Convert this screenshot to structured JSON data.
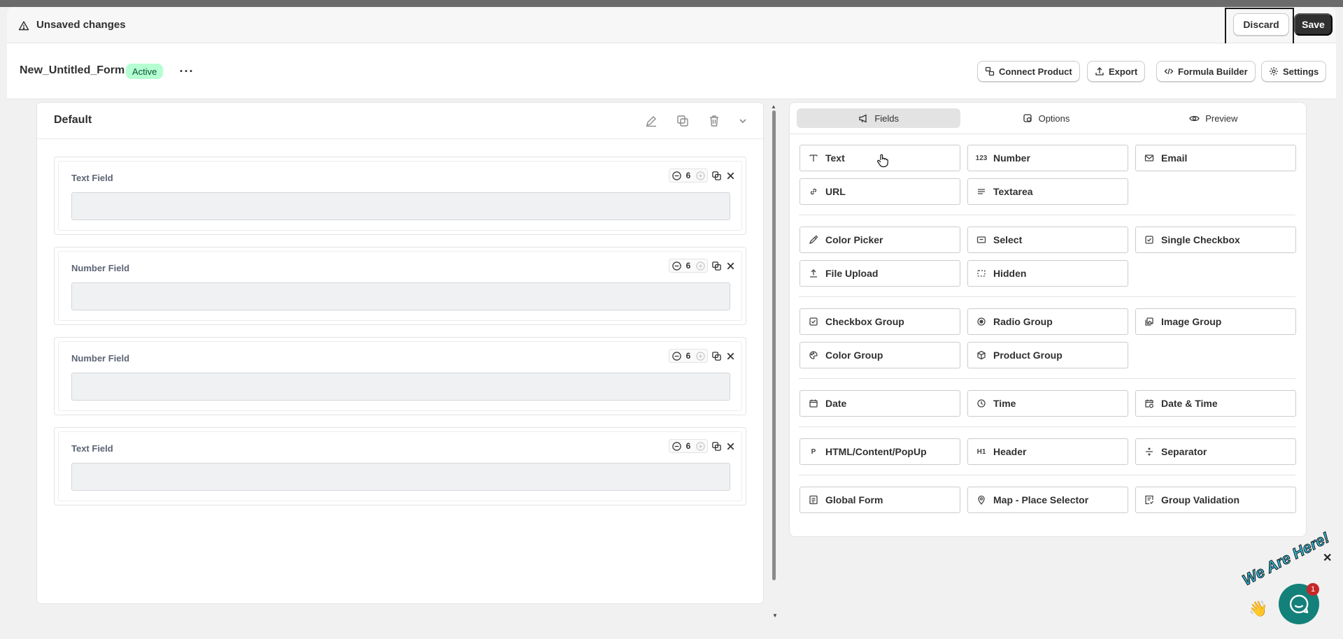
{
  "unsaved": {
    "message": "Unsaved changes",
    "discard": "Discard",
    "save": "Save"
  },
  "header": {
    "form_name": "New_Untitled_Form",
    "status": "Active",
    "more": "···",
    "connect_product": "Connect Product",
    "export": "Export",
    "formula_builder": "Formula Builder",
    "settings": "Settings"
  },
  "section": {
    "title": "Default"
  },
  "fields": [
    {
      "label": "Text Field",
      "width": "6"
    },
    {
      "label": "Number Field",
      "width": "6"
    },
    {
      "label": "Number Field",
      "width": "6"
    },
    {
      "label": "Text Field",
      "width": "6"
    }
  ],
  "tabs": {
    "fields": "Fields",
    "options": "Options",
    "preview": "Preview",
    "active": "Fields"
  },
  "palette": {
    "text": "Text",
    "number": "Number",
    "email": "Email",
    "url": "URL",
    "textarea": "Textarea",
    "color_picker": "Color Picker",
    "select": "Select",
    "single_checkbox": "Single Checkbox",
    "file_upload": "File Upload",
    "hidden": "Hidden",
    "checkbox_group": "Checkbox Group",
    "radio_group": "Radio Group",
    "image_group": "Image Group",
    "color_group": "Color Group",
    "product_group": "Product Group",
    "date": "Date",
    "time": "Time",
    "date_time": "Date & Time",
    "html_content": "HTML/Content/PopUp",
    "header": "Header",
    "separator": "Separator",
    "global_form": "Global Form",
    "map_place": "Map - Place Selector",
    "group_validation": "Group Validation",
    "icon_text": {
      "number": "123",
      "html": "P",
      "header": "H1"
    }
  },
  "chat": {
    "label": "We Are Here!",
    "badge": "1",
    "close": "✕"
  }
}
